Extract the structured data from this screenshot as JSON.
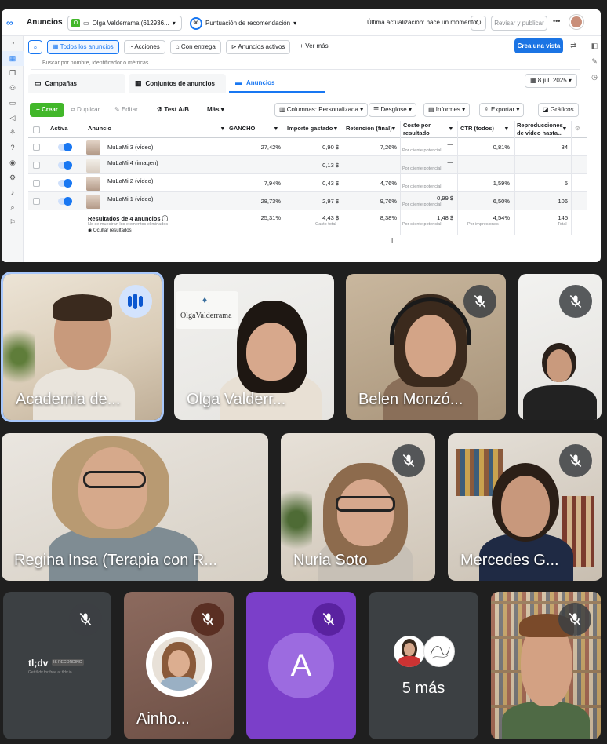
{
  "ads_manager": {
    "app_title": "Anuncios",
    "account_badge": "O",
    "account": "Olga Valderrama (612936...",
    "score_value": "90",
    "score_label": "Puntuación de recomendación",
    "last_update": "Última actualización: hace un momento",
    "review_publish": "Revisar y publicar",
    "toolbar": {
      "all_ads": "Todos los anuncios",
      "actions": "Acciones",
      "with_delivery": "Con entrega",
      "active_ads": "Anuncios activos",
      "see_more": "+ Ver más",
      "create_view": "Crea una vista"
    },
    "search_placeholder": "Buscar por nombre, identificador o métricas",
    "tabs": [
      "Campañas",
      "Conjuntos de anuncios",
      "Anuncios"
    ],
    "date": "8 jul. 2025",
    "actions": {
      "create": "+ Crear",
      "duplicate": "Duplicar",
      "edit": "Editar",
      "ab_test": "Test A/B",
      "more": "Más",
      "columns": "Columnas: Personalizada",
      "breakdown": "Desglose",
      "reports": "Informes",
      "export": "Exportar",
      "charts": "Gráficos"
    },
    "columns": {
      "active": "Activa",
      "ad": "Anuncio",
      "hook": "GANCHO",
      "spent": "Importe gastado",
      "retention": "Retención (final)",
      "cost_1": "Coste por",
      "cost_2": "resultado",
      "ctr": "CTR (todos)",
      "plays_1": "Reproducciones",
      "plays_2": "de vídeo hasta..."
    },
    "rows": [
      {
        "name": "MuLaMi 3 (vídeo)",
        "hook": "27,42%",
        "spent": "0,90 $",
        "retention": "7,26%",
        "cost": "—",
        "cost_sub": "Por cliente potencial",
        "ctr": "0,81%",
        "plays": "34"
      },
      {
        "name": "MuLaMi 4 (imagen)",
        "hook": "—",
        "spent": "0,13 $",
        "retention": "—",
        "cost": "—",
        "cost_sub": "Por cliente potencial",
        "ctr": "—",
        "plays": "—"
      },
      {
        "name": "MuLaMi 2 (vídeo)",
        "hook": "7,94%",
        "spent": "0,43 $",
        "retention": "4,76%",
        "cost": "—",
        "cost_sub": "Por cliente potencial",
        "ctr": "1,59%",
        "plays": "5"
      },
      {
        "name": "MuLaMi 1 (vídeo)",
        "hook": "28,73%",
        "spent": "2,97 $",
        "retention": "9,76%",
        "cost": "0,99 $",
        "cost_sub": "Por cliente potencial",
        "ctr": "6,50%",
        "plays": "106"
      }
    ],
    "totals": {
      "label": "Resultados de 4 anuncios",
      "note": "No se muestran los elementos eliminados",
      "hide": "Ocultar resultados",
      "hook": "25,31%",
      "spent": "4,43 $",
      "spent_sub": "Gasto total",
      "retention": "8,38%",
      "cost": "1,48 $",
      "cost_sub": "Por cliente potencial",
      "ctr": "4,54%",
      "ctr_sub": "Por impresiones",
      "plays": "145",
      "plays_sub": "Total"
    }
  },
  "participants": {
    "academia": "Academia de...",
    "olga": "Olga Valderr...",
    "olga_sign": "OlgaValderrama",
    "belen": "Belen Monzó...",
    "regina": "Regina Insa (Terapia con R...",
    "nuria": "Nuria Soto",
    "mercedes": "Mercedes G...",
    "tldv_logo": "tl;dv",
    "tldv_badge": "IS RECORDING",
    "tldv_sub": "Get tl;dv for free at tldv.io",
    "ainhoa": "Ainho...",
    "a_initial": "A",
    "more": "5 más"
  }
}
